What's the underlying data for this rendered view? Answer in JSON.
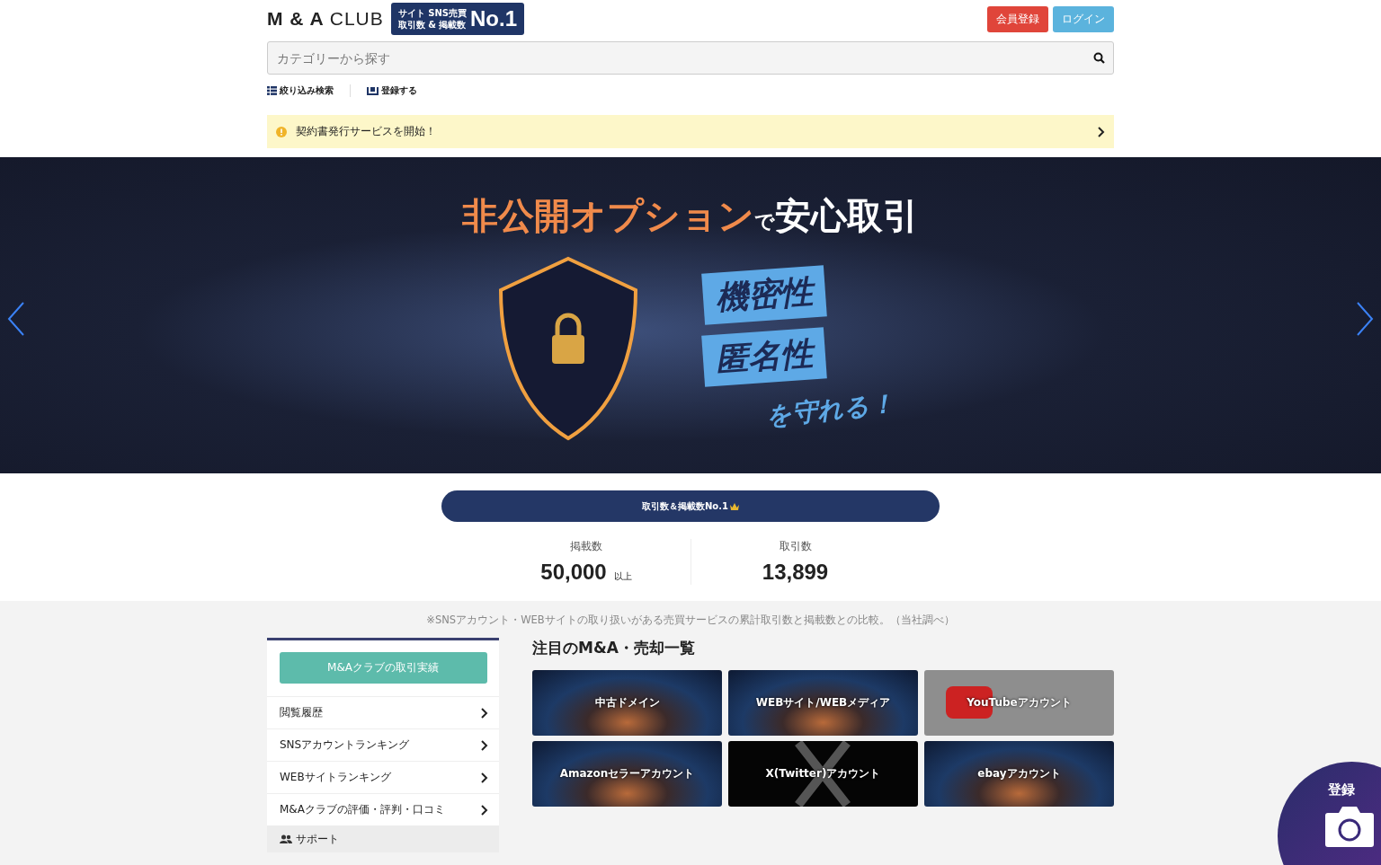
{
  "header": {
    "logo_main": "M & A",
    "logo_sub": "CLUB",
    "badge_top": "サイト SNS売買",
    "badge_bottom": "取引数 & 掲載数",
    "badge_big": "No.1",
    "buttons": [
      {
        "label": "会員登録",
        "kind": "signup"
      },
      {
        "label": "ログイン",
        "kind": "login"
      }
    ]
  },
  "search": {
    "placeholder": "カテゴリーから探す"
  },
  "links": [
    {
      "label": "絞り込み検索",
      "kind": "filter"
    },
    {
      "label": "登録する",
      "kind": "register"
    }
  ],
  "notice": {
    "text": "契約書発行サービスを開始！"
  },
  "banner": {
    "accent": "非公開オプション",
    "particle": "で",
    "headline": "安心取引",
    "tags": [
      "機密性",
      "匿名性"
    ],
    "tagline": "を守れる！"
  },
  "stats": {
    "title": "取引数＆掲載数No.1",
    "items": [
      {
        "label": "掲載数",
        "value": "50,000",
        "suffix": "以上"
      },
      {
        "label": "取引数",
        "value": "13,899"
      }
    ],
    "note": "※SNSアカウント・WEBサイトの取り扱いがある売買サービスの累計取引数と掲載数との比較。（当社調べ）"
  },
  "sidebar": {
    "button": "M&Aクラブの取引実績",
    "items": [
      "閲覧履歴",
      "SNSアカウントランキング",
      "WEBサイトランキング",
      "M&Aクラブの評価・評判・口コミ"
    ],
    "section": "サポート"
  },
  "featured": {
    "title": "注目のM&A・売却一覧",
    "tiles": [
      {
        "label": "中古ドメイン",
        "kind": "photo"
      },
      {
        "label": "WEBサイト/WEBメディア",
        "kind": "photo"
      },
      {
        "label": "YouTubeアカウント",
        "kind": "youtube"
      },
      {
        "label": "Amazonセラーアカウント",
        "kind": "photo"
      },
      {
        "label": "X(Twitter)アカウント",
        "kind": "x"
      },
      {
        "label": "ebayアカウント",
        "kind": "photo"
      }
    ]
  },
  "fab": {
    "label": "登録"
  }
}
